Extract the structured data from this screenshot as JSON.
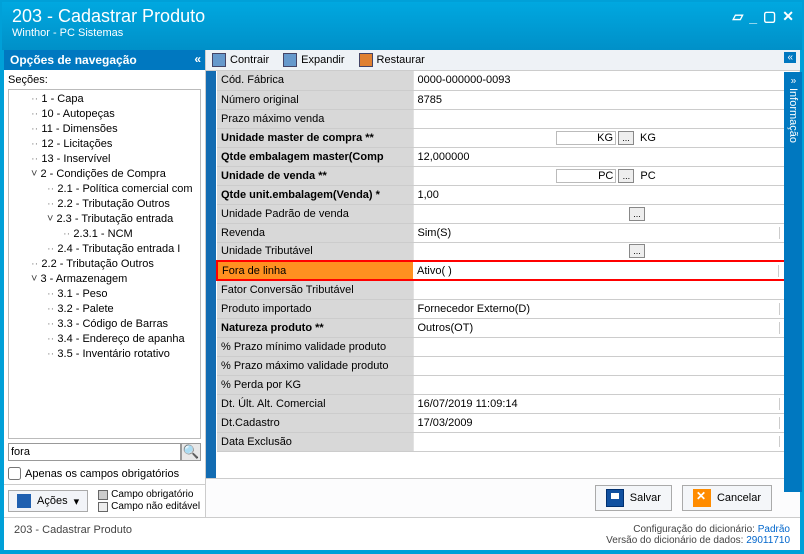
{
  "window": {
    "title": "203 - Cadastrar  Produto",
    "subtitle": "Winthor - PC Sistemas"
  },
  "nav": {
    "header": "Opções de navegação",
    "sections_label": "Seções:",
    "tree": [
      {
        "t": "1 - Capa",
        "c": "i1 node"
      },
      {
        "t": "10 - Autopeças",
        "c": "i1 node"
      },
      {
        "t": "11 - Dimensões",
        "c": "i1 node"
      },
      {
        "t": "12 - Licitações",
        "c": "i1 node"
      },
      {
        "t": "13 - Inservível",
        "c": "i1 node"
      },
      {
        "t": "2 - Condições de Compra",
        "c": "i1 exp"
      },
      {
        "t": "2.1 - Política comercial com",
        "c": "i2 node"
      },
      {
        "t": "2.2 - Tributação Outros",
        "c": "i2 node"
      },
      {
        "t": "2.3 - Tributação entrada",
        "c": "i2 exp"
      },
      {
        "t": "2.3.1 - NCM",
        "c": "i3 node"
      },
      {
        "t": "2.4 - Tributação entrada I",
        "c": "i2 node"
      },
      {
        "t": "2.2 - Tributação Outros",
        "c": "i1 node"
      },
      {
        "t": "3 - Armazenagem",
        "c": "i1 exp"
      },
      {
        "t": "3.1 - Peso",
        "c": "i2 node"
      },
      {
        "t": "3.2 - Palete",
        "c": "i2 node"
      },
      {
        "t": "3.3 - Código de Barras",
        "c": "i2 node"
      },
      {
        "t": "3.4 - Endereço de apanha",
        "c": "i2 node"
      },
      {
        "t": "3.5 - Inventário rotativo",
        "c": "i2 node"
      }
    ],
    "search_value": "fora",
    "only_required": "Apenas os campos obrigatórios",
    "acoes": "Ações",
    "legend1": "Campo obrigatório",
    "legend2": "Campo não editável"
  },
  "toolbar": {
    "contrair": "Contrair",
    "expandir": "Expandir",
    "restaurar": "Restaurar"
  },
  "rows": [
    {
      "label": "Cód. Fábrica",
      "value": "0000-000000-0093",
      "type": "text"
    },
    {
      "label": "Número original",
      "value": "8785",
      "type": "text"
    },
    {
      "label": "Prazo máximo venda",
      "value": "",
      "type": "text"
    },
    {
      "label": "Unidade master de compra **",
      "value": "KG",
      "tail": "KG",
      "type": "unit",
      "bold": true
    },
    {
      "label": "Qtde embalagem master(Comp",
      "value": "12,000000",
      "type": "text",
      "bold": true
    },
    {
      "label": "Unidade de venda **",
      "value": "PC",
      "tail": "PC",
      "type": "unit",
      "bold": true
    },
    {
      "label": "Qtde unit.embalagem(Venda) *",
      "value": "1,00",
      "type": "text",
      "bold": true
    },
    {
      "label": "Unidade Padrão de venda",
      "value": "",
      "type": "dots"
    },
    {
      "label": "Revenda",
      "value": "Sim(S)",
      "type": "dd"
    },
    {
      "label": "Unidade Tributável",
      "value": "",
      "type": "dots"
    },
    {
      "label": "Fora de linha",
      "value": "Ativo(  )",
      "type": "dd",
      "hl": true
    },
    {
      "label": "Fator Conversão Tributável",
      "value": "",
      "type": "text"
    },
    {
      "label": "Produto importado",
      "value": "Fornecedor Externo(D)",
      "type": "dd"
    },
    {
      "label": "Natureza produto **",
      "value": "Outros(OT)",
      "type": "dd",
      "bold": true
    },
    {
      "label": "% Prazo mínimo validade produto",
      "value": "",
      "type": "text"
    },
    {
      "label": "% Prazo máximo validade produto",
      "value": "",
      "type": "text"
    },
    {
      "label": "% Perda por KG",
      "value": "",
      "type": "text"
    },
    {
      "label": "Dt. Últ. Alt. Comercial",
      "value": "16/07/2019 11:09:14",
      "type": "dd"
    },
    {
      "label": "Dt.Cadastro",
      "value": "17/03/2009",
      "type": "dd"
    },
    {
      "label": "Data Exclusão",
      "value": "",
      "type": "dd"
    }
  ],
  "side": "Informação",
  "buttons": {
    "save": "Salvar",
    "cancel": "Cancelar"
  },
  "status": {
    "left": "203 - Cadastrar  Produto",
    "cfg_label": "Configuração do dicionário:",
    "cfg_value": "Padrão",
    "ver_label": "Versão do dicionário de dados:",
    "ver_value": "29011710"
  }
}
